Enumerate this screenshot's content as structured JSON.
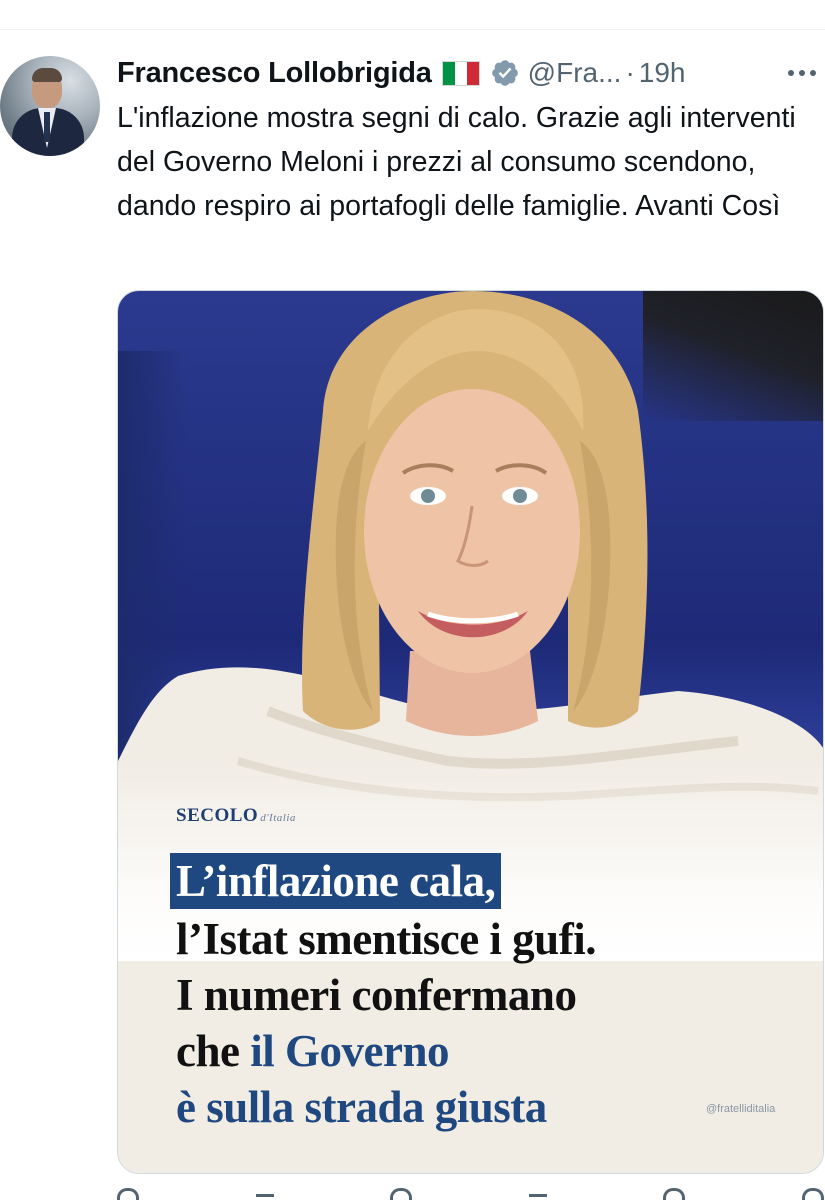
{
  "author": {
    "name": "Francesco Lollobrigida",
    "handle": "@Fra...",
    "time_separator": "·",
    "timestamp": "19h"
  },
  "icons": {
    "flag": "italy-flag-icon",
    "verified": "verified-badge-icon",
    "more": "more-options-icon",
    "avatar": "profile-avatar"
  },
  "colors": {
    "verified_badge": "#829aab",
    "flag_green": "#009246",
    "flag_white": "#ffffff",
    "flag_red": "#ce2b37",
    "headline_blue": "#1f4880"
  },
  "tweet": {
    "text": "L'inflazione mostra segni di calo. Grazie agli interventi del Governo Meloni i prezzi al consumo scendono, dando respiro ai portafogli delle famiglie. Avanti Così"
  },
  "media": {
    "logo_main": "SECOLO",
    "logo_sub": "d'Italia",
    "headline_line1": "L’inflazione cala,",
    "headline_line2": "l’Istat smentisce i gufi.",
    "headline_line3": "I numeri confermano",
    "headline_line4_plain": "che ",
    "headline_line4_blue": "il Governo",
    "headline_line5": "è sulla strada giusta",
    "watermark": "@fratelliditalia"
  }
}
